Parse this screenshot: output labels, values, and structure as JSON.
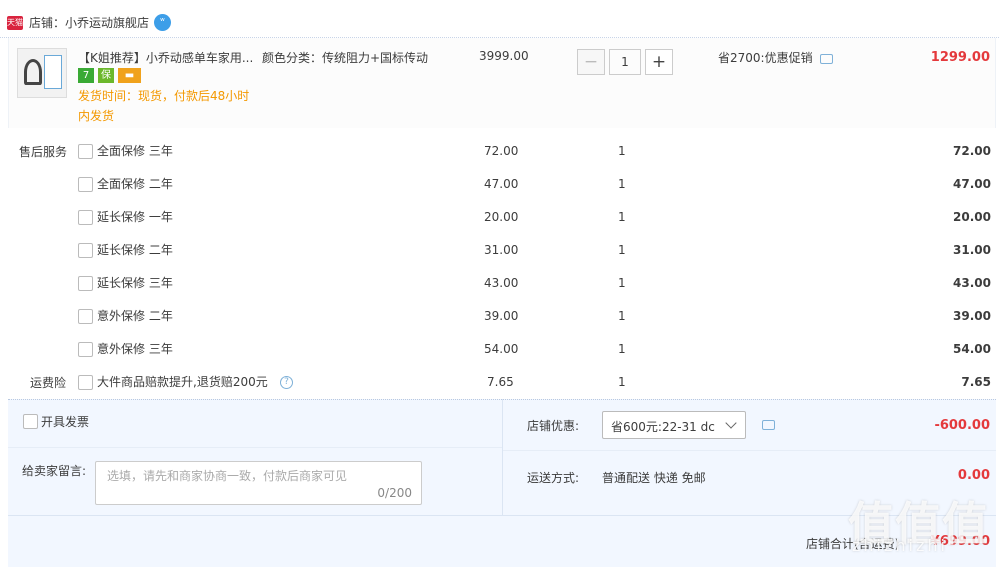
{
  "shop": {
    "badge": "天猫",
    "name": "店铺：小乔运动旗舰店",
    "ww_icon_glyph": "ʷ"
  },
  "item": {
    "title": "【K姐推荐】小乔动感单车家用...",
    "sku": "颜色分类：传统阻力+国标传动",
    "tags": [
      "7",
      "保",
      "▬"
    ],
    "ship_time": "发货时间：现货，付款后48小时内发货",
    "unit_price": "3999.00",
    "qty_minus": "−",
    "qty": "1",
    "qty_plus": "+",
    "promo": "省2700:优惠促销",
    "subtotal": "1299.00"
  },
  "services": {
    "title": "售后服务",
    "rows": [
      {
        "name": "全面保修 三年",
        "price": "72.00",
        "qty": "1",
        "sum": "72.00"
      },
      {
        "name": "全面保修 二年",
        "price": "47.00",
        "qty": "1",
        "sum": "47.00"
      },
      {
        "name": "延长保修 一年",
        "price": "20.00",
        "qty": "1",
        "sum": "20.00"
      },
      {
        "name": "延长保修 二年",
        "price": "31.00",
        "qty": "1",
        "sum": "31.00"
      },
      {
        "name": "延长保修 三年",
        "price": "43.00",
        "qty": "1",
        "sum": "43.00"
      },
      {
        "name": "意外保修 二年",
        "price": "39.00",
        "qty": "1",
        "sum": "39.00"
      },
      {
        "name": "意外保修 三年",
        "price": "54.00",
        "qty": "1",
        "sum": "54.00"
      }
    ]
  },
  "shipping_insurance": {
    "label": "运费险",
    "name": "大件商品赔款提升,退货赔200元",
    "help_glyph": "?",
    "price": "7.65",
    "qty": "1",
    "sum": "7.65"
  },
  "invoice": {
    "label": "开具发票"
  },
  "message": {
    "label": "给卖家留言:",
    "placeholder": "选填，请先和商家协商一致，付款后商家可见",
    "count": "0/200"
  },
  "coupon": {
    "label": "店铺优惠:",
    "selected": "省600元:22-31 dc",
    "amount": "-600.00"
  },
  "delivery": {
    "label": "运送方式:",
    "value": "普通配送 快递 免邮",
    "amount": "0.00"
  },
  "total": {
    "label": "店铺合计(含运费)",
    "amount": "¥699.00"
  },
  "watermark": {
    "text": "值值值",
    "sub": "zhizhizhi"
  },
  "colors": {
    "price_red": "#e4393c",
    "ship_orange": "#f39800",
    "bottom_bg": "#f2f7ff",
    "tmall_red": "#d9233e"
  }
}
